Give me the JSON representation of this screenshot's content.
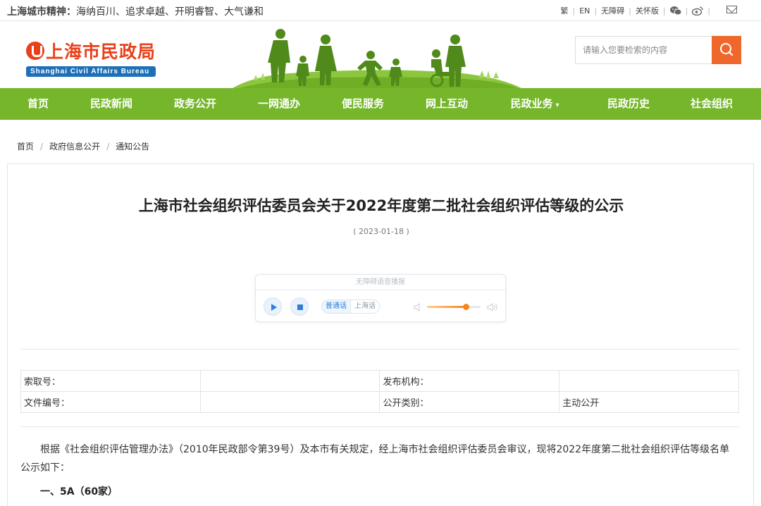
{
  "topbar": {
    "motto_label": "上海城市精神：",
    "motto_text": "海纳百川、追求卓越、开明睿智、大气谦和",
    "links": [
      "繁",
      "EN",
      "无障碍",
      "关怀版"
    ],
    "icons": [
      "wechat-icon",
      "weibo-icon",
      "mail-icon"
    ]
  },
  "header": {
    "logo_cn": "上海市民政局",
    "logo_en": "Shanghai Civil Affairs Bureau",
    "search_placeholder": "请输入您要检索的内容"
  },
  "nav": {
    "items": [
      "首页",
      "民政新闻",
      "政务公开",
      "一网通办",
      "便民服务",
      "网上互动",
      "民政业务",
      "民政历史",
      "社会组织"
    ]
  },
  "breadcrumb": [
    "首页",
    "政府信息公开",
    "通知公告"
  ],
  "article": {
    "title": "上海市社会组织评估委员会关于2022年度第二批社会组织评估等级的公示",
    "date": "( 2023-01-18 )",
    "player": {
      "header": "无障碍语音播报",
      "lang_active": "普通话",
      "lang_other": "上海话",
      "volume_level": 0.72
    },
    "meta": {
      "index_label": "索取号：",
      "index_value": "",
      "publisher_label": "发布机构：",
      "publisher_value": "",
      "doc_label": "文件编号：",
      "doc_value": "",
      "category_label": "公开类别：",
      "category_value": "主动公开"
    },
    "paragraph": "根据《社会组织评估管理办法》（2010年民政部令第39号）及本市有关规定，经上海市社会组织评估委员会审议，现将2022年度第二批社会组织评估等级名单公示如下：",
    "section_1": "一、5A（60家）"
  },
  "colors": {
    "nav_green": "#75b62b",
    "brand_red": "#e8411a",
    "search_orange": "#f0672b",
    "player_blue": "#2f7fd8"
  }
}
